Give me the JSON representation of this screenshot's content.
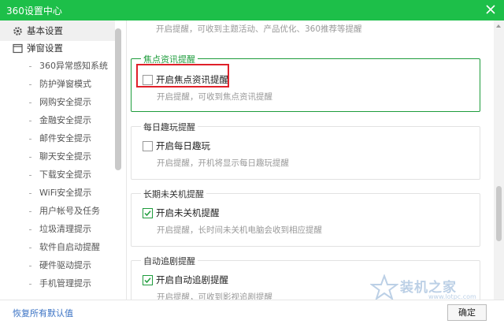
{
  "window": {
    "title": "360设置中心"
  },
  "sidebar": {
    "sections": [
      {
        "label": "基本设置",
        "icon": "gear-icon"
      },
      {
        "label": "弹窗设置",
        "icon": "window-icon"
      }
    ],
    "items": [
      "360异常感知系统",
      "防护弹窗模式",
      "网购安全提示",
      "金融安全提示",
      "邮件安全提示",
      "聊天安全提示",
      "下载安全提示",
      "WiFi安全提示",
      "用户帐号及任务",
      "垃圾清理提示",
      "软件自启动提醒",
      "硬件驱动提示",
      "手机管理提示"
    ]
  },
  "main": {
    "top_desc": "开启提醒，可收到主题活动、产品优化、360推荐等提醒",
    "groups": [
      {
        "title": "焦点资讯提醒",
        "option": "开启焦点资讯提醒",
        "checked": false,
        "desc": "开启提醒，可收到焦点资讯提醒"
      },
      {
        "title": "每日趣玩提醒",
        "option": "开启每日趣玩",
        "checked": false,
        "desc": "开启提醒，开机将显示每日趣玩提醒"
      },
      {
        "title": "长期未关机提醒",
        "option": "开启未关机提醒",
        "checked": true,
        "desc": "开启提醒，长时间未关机电脑会收到相应提醒"
      },
      {
        "title": "自动追剧提醒",
        "option": "开启自动追剧提醒",
        "checked": true,
        "desc": "开启提醒，可收到影视追剧提醒"
      }
    ]
  },
  "footer": {
    "restore": "恢复所有默认值",
    "ok": "确定"
  },
  "watermark": {
    "text": "装机之家",
    "url": "www.lotpc.com"
  },
  "colors": {
    "title_bar": "#1dbf49",
    "accent": "#1e9c3c",
    "highlight": "#e0202a",
    "link": "#3a72c4"
  }
}
